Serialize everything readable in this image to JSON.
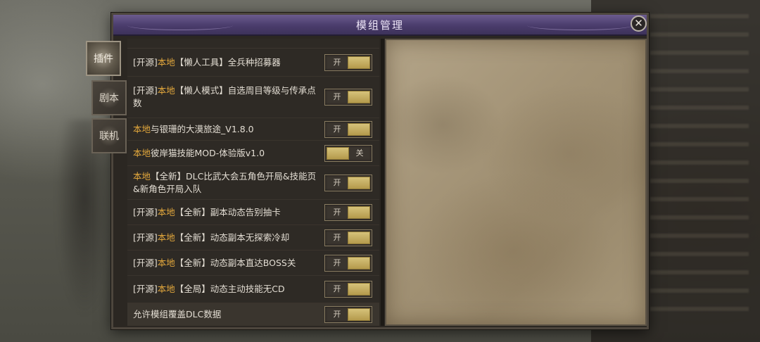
{
  "window": {
    "title": "模组管理"
  },
  "close_glyph": "✕",
  "tabs": [
    {
      "label": "插件",
      "active": true
    },
    {
      "label": "剧本",
      "active": false
    },
    {
      "label": "联机",
      "active": false
    }
  ],
  "mods": [
    {
      "prefix": "[开源]",
      "local": "本地",
      "name": "【懒人工具】全兵种招募器",
      "toggle": "开",
      "on": true
    },
    {
      "prefix": "[开源]",
      "local": "本地",
      "name": "【懒人模式】自选周目等级与传承点数",
      "toggle": "开",
      "on": true
    },
    {
      "prefix": "",
      "local": "本地",
      "name": "与银珊的大漠旅途_V1.8.0",
      "toggle": "开",
      "on": true
    },
    {
      "prefix": "",
      "local": "本地",
      "name": "彼岸猫技能MOD-体验版v1.0",
      "toggle": "关",
      "on": false
    },
    {
      "prefix": "",
      "local": "本地",
      "name": "【全新】DLC比武大会五角色开局&技能页&新角色开局入队",
      "toggle": "开",
      "on": true
    },
    {
      "prefix": "[开源]",
      "local": "本地",
      "name": "【全新】副本动态告别抽卡",
      "toggle": "开",
      "on": true
    },
    {
      "prefix": "[开源]",
      "local": "本地",
      "name": "【全新】动态副本无探索冷却",
      "toggle": "开",
      "on": true
    },
    {
      "prefix": "[开源]",
      "local": "本地",
      "name": "【全新】动态副本直达BOSS关",
      "toggle": "开",
      "on": true
    },
    {
      "prefix": "[开源]",
      "local": "本地",
      "name": "【全局】动态主动技能无CD",
      "toggle": "开",
      "on": true
    }
  ],
  "dlc_override": {
    "label": "允许模组覆盖DLC数据",
    "toggle": "开",
    "on": true
  },
  "colors": {
    "accent_local": "#e2a73c",
    "title_bar": "#4a3c6c",
    "toggle_knob": "#c8b060"
  }
}
